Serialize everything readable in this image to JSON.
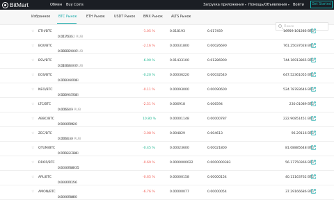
{
  "header": {
    "logo_text": "BitMart",
    "nav": [
      {
        "label": "Обмен"
      },
      {
        "label": "Buy Coins"
      }
    ],
    "download": "Загрузка приложения",
    "help": "Помощь/Объявления",
    "login": "Войти",
    "signup": "Get Started"
  },
  "tabs": [
    {
      "label": "Избранное",
      "active": false
    },
    {
      "label": "BTC Рынок",
      "active": true
    },
    {
      "label": "ETH Рынок",
      "active": false
    },
    {
      "label": "USDT Рынок",
      "active": false
    },
    {
      "label": "BMX Рынок",
      "active": false
    },
    {
      "label": "ALTS Рынок",
      "active": false
    }
  ],
  "search": {
    "placeholder": "Поиск"
  },
  "colors": {
    "accent": "#18a9a9",
    "up": "#1db58f",
    "down": "#f05a51",
    "header_bg": "#1b1e24"
  },
  "rows": [
    {
      "pair": "ETH/BTC",
      "price": "0.017635",
      "price_sub": " / 11146.62 RUB",
      "change": "-1.05 %",
      "dir": "down",
      "high": "0.018193",
      "low": "0.017459",
      "volume": "16959.101285 BTC"
    },
    {
      "pair": "BOX/BTC",
      "price": "0.00002000",
      "price_sub": " / 10623.78 RUB",
      "change": "-2.16 %",
      "dir": "down",
      "high": "0.00031800",
      "low": "0.00026690",
      "volume": "761.25037028 BTC"
    },
    {
      "pair": "BSV/BTC",
      "price": "0.01366800",
      "price_sub": " / 25927.80 RUB",
      "change": "-6.90 %",
      "dir": "up",
      "high": "0.01433100",
      "low": "0.01286900",
      "volume": "744.16913865 BTC"
    },
    {
      "pair": "EOS/BTC",
      "price": "0.00036000",
      "price_sub": " / 226.89 RUB",
      "change": "-0.20 %",
      "dir": "up",
      "high": "0.00036220",
      "low": "0.00032540",
      "volume": "647.52361055 BTC"
    },
    {
      "pair": "NEO/BTC",
      "price": "0.00091500",
      "price_sub": " / 586.38 RUB",
      "change": "-0.11 %",
      "dir": "down",
      "high": "0.00093000",
      "low": "0.00090600",
      "volume": "524.78783646 BTC"
    },
    {
      "pair": "LTC/BTC",
      "price": "0.006643",
      "price_sub": " / 4213.59 RUB",
      "change": "-2.51 %",
      "dir": "down",
      "high": "0.006918",
      "low": "0.006594",
      "volume": "230.01089 BTC"
    },
    {
      "pair": "ABBC/BTC",
      "price": "0.00000920",
      "price_sub": " / 5.83 RUB",
      "change": "10.80 %",
      "dir": "up",
      "high": "0.00001148",
      "low": "0.00000787",
      "volume": "222.90851451 BTC"
    },
    {
      "pair": "ZEC/BTC",
      "price": "0.006433",
      "price_sub": " / 2932.20 RUB",
      "change": "-3.08 %",
      "dir": "down",
      "high": "0.004829",
      "low": "0.004613",
      "volume": "96.29116 BTC"
    },
    {
      "pair": "QTUM/BTC",
      "price": "0.00022380",
      "price_sub": " / 141.44 RUB",
      "change": "-0.45 %",
      "dir": "up",
      "high": "0.00023600",
      "low": "0.00021800",
      "volume": "81.08885648 BTC"
    },
    {
      "pair": "DROP/BTC",
      "price": "0.000000035",
      "price_sub": " / 0.01 RUB",
      "change": "-0.69 %",
      "dir": "down",
      "high": "0.0000000022",
      "low": "0.0000000383",
      "volume": "56.17750366 BTC"
    },
    {
      "pair": "APL/BTC",
      "price": "0.00000156",
      "price_sub": " / 0.97 RUB",
      "change": "-0.65 %",
      "dir": "down",
      "high": "0.00000158",
      "low": "0.00000154",
      "volume": "40.11163762 BTC"
    },
    {
      "pair": "AMON/BTC",
      "price": "0.00000060",
      "price_sub": " / 0.38 RUB",
      "change": "-6.76 %",
      "dir": "down",
      "high": "0.00000077",
      "low": "0.00000054",
      "volume": "37.29166686 BTC"
    }
  ]
}
